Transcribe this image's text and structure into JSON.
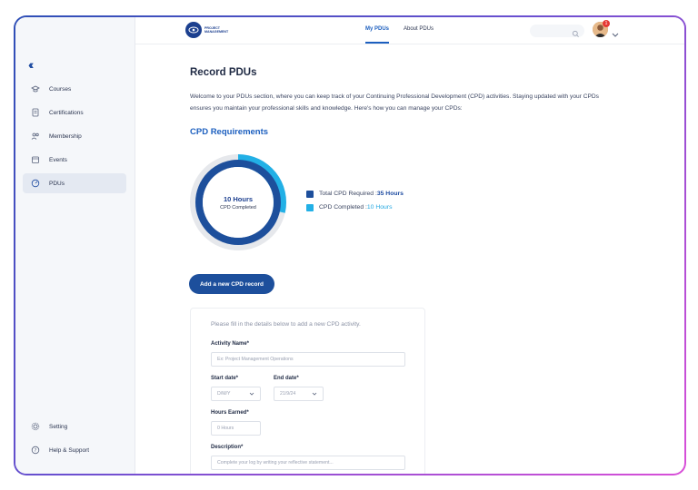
{
  "sidebar": {
    "items": [
      {
        "label": "Courses",
        "icon": "graduation-cap-icon"
      },
      {
        "label": "Certifications",
        "icon": "certificate-icon"
      },
      {
        "label": "Membership",
        "icon": "membership-icon"
      },
      {
        "label": "Events",
        "icon": "calendar-icon"
      },
      {
        "label": "PDUs",
        "icon": "gauge-icon"
      }
    ],
    "bottom_items": [
      {
        "label": "Setting",
        "icon": "gear-icon"
      },
      {
        "label": "Help & Support",
        "icon": "help-icon"
      }
    ]
  },
  "header": {
    "logo_text": "PROJECT MANAGEMENT",
    "tabs": [
      {
        "label": "My PDUs",
        "active": true
      },
      {
        "label": "About PDUs",
        "active": false
      }
    ],
    "notification_count": "1"
  },
  "main": {
    "title": "Record PDUs",
    "intro": "Welcome to your PDUs section, where you can keep track of your Continuing Professional Development (CPD) activities. Staying updated with your CPDs ensures you maintain your professional skills and knowledge. Here's how you can manage your CPDs:",
    "cpd_heading": "CPD Requirements",
    "donut_value": "10 Hours",
    "donut_label": "CPD Completed",
    "legend": {
      "total_label": "Total CPD Required : ",
      "total_value": "35 Hours",
      "completed_label": "CPD Completed : ",
      "completed_value": "10 Hours"
    },
    "add_button": "Add a new CPD record"
  },
  "form": {
    "intro": "Please fill in the details below to add a new CPD activity.",
    "activity_label": "Activity Name*",
    "activity_placeholder": "Ex: Project Management Operations",
    "start_label": "Start date*",
    "start_value": "D/M/Y",
    "end_label": "End date*",
    "end_value": "21/9/24",
    "hours_label": "Hours Earned*",
    "hours_placeholder": "0 Hours",
    "description_label": "Description*",
    "description_placeholder": "Complete your log by writing your reflective statement..."
  },
  "chart_data": {
    "type": "pie",
    "values": [
      10,
      25
    ],
    "colors": [
      "#22b0e6",
      "#1d4f9c"
    ]
  },
  "colors": {
    "primary": "#1d4f9c",
    "accent": "#22b0e6",
    "heading": "#1c5fbf"
  }
}
